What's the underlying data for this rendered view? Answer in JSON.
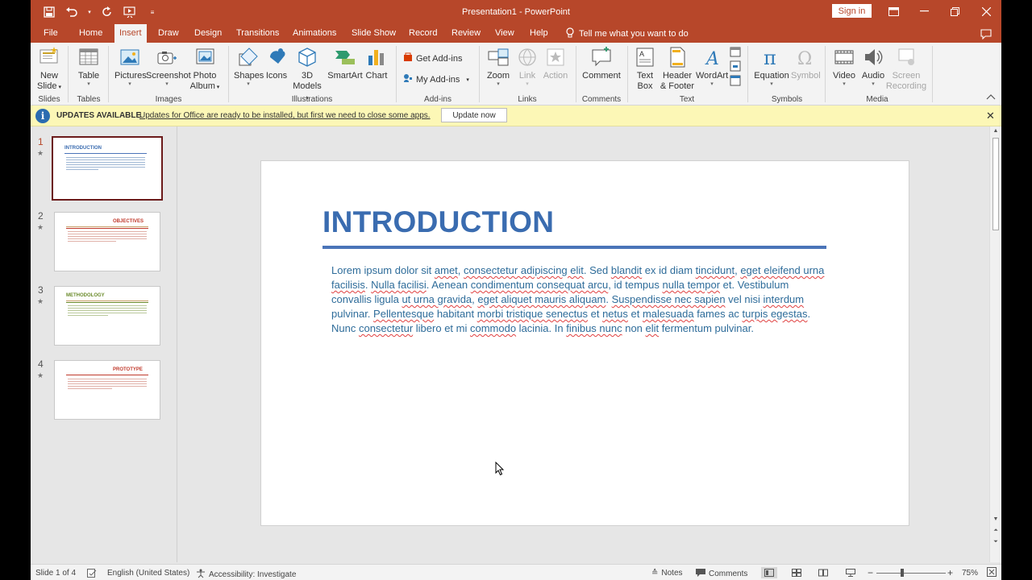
{
  "window": {
    "title": "Presentation1  -  PowerPoint",
    "sign_in": "Sign in"
  },
  "menu_tabs": [
    "File",
    "Home",
    "Insert",
    "Draw",
    "Design",
    "Transitions",
    "Animations",
    "Slide Show",
    "Record",
    "Review",
    "View",
    "Help"
  ],
  "active_tab": "Insert",
  "tell_me": "Tell me what you want to do",
  "ribbon": {
    "new_slide": [
      "New",
      "Slide"
    ],
    "table": "Table",
    "pictures": "Pictures",
    "screenshot": "Screenshot",
    "photo_album": [
      "Photo",
      "Album"
    ],
    "shapes": "Shapes",
    "icons": "Icons",
    "models_3d": [
      "3D",
      "Models"
    ],
    "smartart": "SmartArt",
    "chart": "Chart",
    "get_addins": "Get Add-ins",
    "my_addins": "My Add-ins",
    "zoom": "Zoom",
    "link": "Link",
    "action": "Action",
    "comment": "Comment",
    "text_box": [
      "Text",
      "Box"
    ],
    "header_footer": [
      "Header",
      "& Footer"
    ],
    "wordart": "WordArt",
    "equation": "Equation",
    "symbol": "Symbol",
    "video": "Video",
    "audio": "Audio",
    "screen_recording": [
      "Screen",
      "Recording"
    ],
    "groups": {
      "slides": "Slides",
      "tables": "Tables",
      "images": "Images",
      "illustrations": "Illustrations",
      "addins": "Add-ins",
      "links": "Links",
      "comments": "Comments",
      "text": "Text",
      "symbols": "Symbols",
      "media": "Media"
    }
  },
  "notification": {
    "title": "UPDATES AVAILABLE",
    "message": "Updates for Office are ready to be installed, but first we need to close some apps.",
    "button": "Update now"
  },
  "slides": [
    {
      "number": "1",
      "title": "INTRODUCTION",
      "color": "#3a6cb0"
    },
    {
      "number": "2",
      "title": "OBJECTIVES",
      "color": "#c0392b"
    },
    {
      "number": "3",
      "title": "METHODOLOGY",
      "color": "#6a8a2a"
    },
    {
      "number": "4",
      "title": "PROTOTYPE",
      "color": "#c0392b"
    }
  ],
  "current_slide": {
    "title": "INTRODUCTION",
    "body": "Lorem ipsum dolor sit amet, consectetur adipiscing elit. Sed blandit ex id diam tincidunt, eget eleifend urna facilisis. Nulla facilisi. Aenean condimentum consequat arcu, id tempus nulla tempor et. Vestibulum convallis ligula ut urna gravida, eget aliquet mauris aliquam. Suspendisse nec sapien vel nisi interdum pulvinar. Pellentesque habitant morbi tristique senectus et netus et malesuada fames ac turpis egestas. Nunc consectetur libero et mi commodo lacinia. In finibus nunc non elit fermentum pulvinar."
  },
  "status": {
    "slide_count": "Slide 1 of 4",
    "language": "English (United States)",
    "accessibility": "Accessibility: Investigate",
    "notes": "Notes",
    "comments": "Comments",
    "zoom_minus": "−",
    "zoom_plus": "+",
    "zoom_level": "75%"
  },
  "colors": {
    "accent": "#b7472a",
    "slide_title": "#3a6cb0",
    "body_text": "#2e6c9a"
  }
}
